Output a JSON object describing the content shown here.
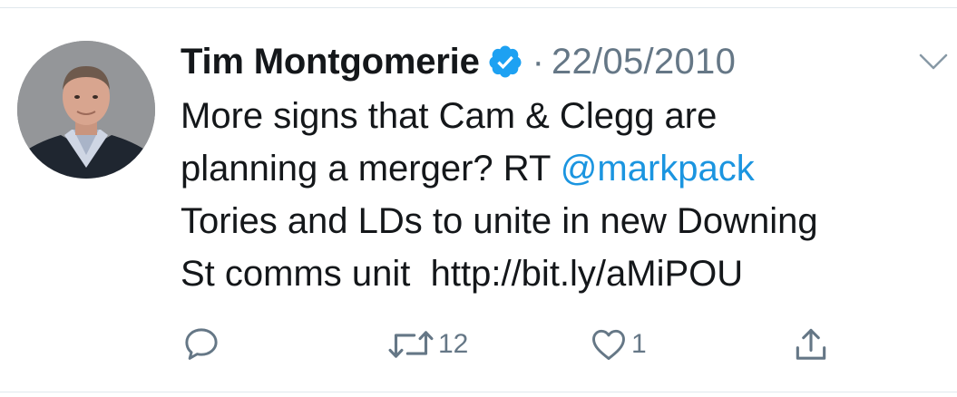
{
  "tweet": {
    "author_name": "Tim Montgomerie",
    "separator": "·",
    "date": "22/05/2010",
    "text_line1": "More signs that Cam & Clegg are",
    "text_line2_pre": "planning a merger? RT ",
    "mention": "@markpack",
    "text_line3": "Tories and LDs to unite in new Downing",
    "text_line4": "St comms unit  http://bit.ly/aMiPOU"
  },
  "actions": {
    "reply_icon": "speech-bubble-icon",
    "retweet_icon": "retweet-arrows-icon",
    "retweet_count": "12",
    "like_icon": "heart-icon",
    "like_count": "1",
    "share_icon": "share-upload-icon"
  },
  "colors": {
    "text": "#14171a",
    "secondary": "#657786",
    "link": "#1b95e0",
    "verified": "#1da1f2",
    "divider": "#e1e8ed"
  }
}
